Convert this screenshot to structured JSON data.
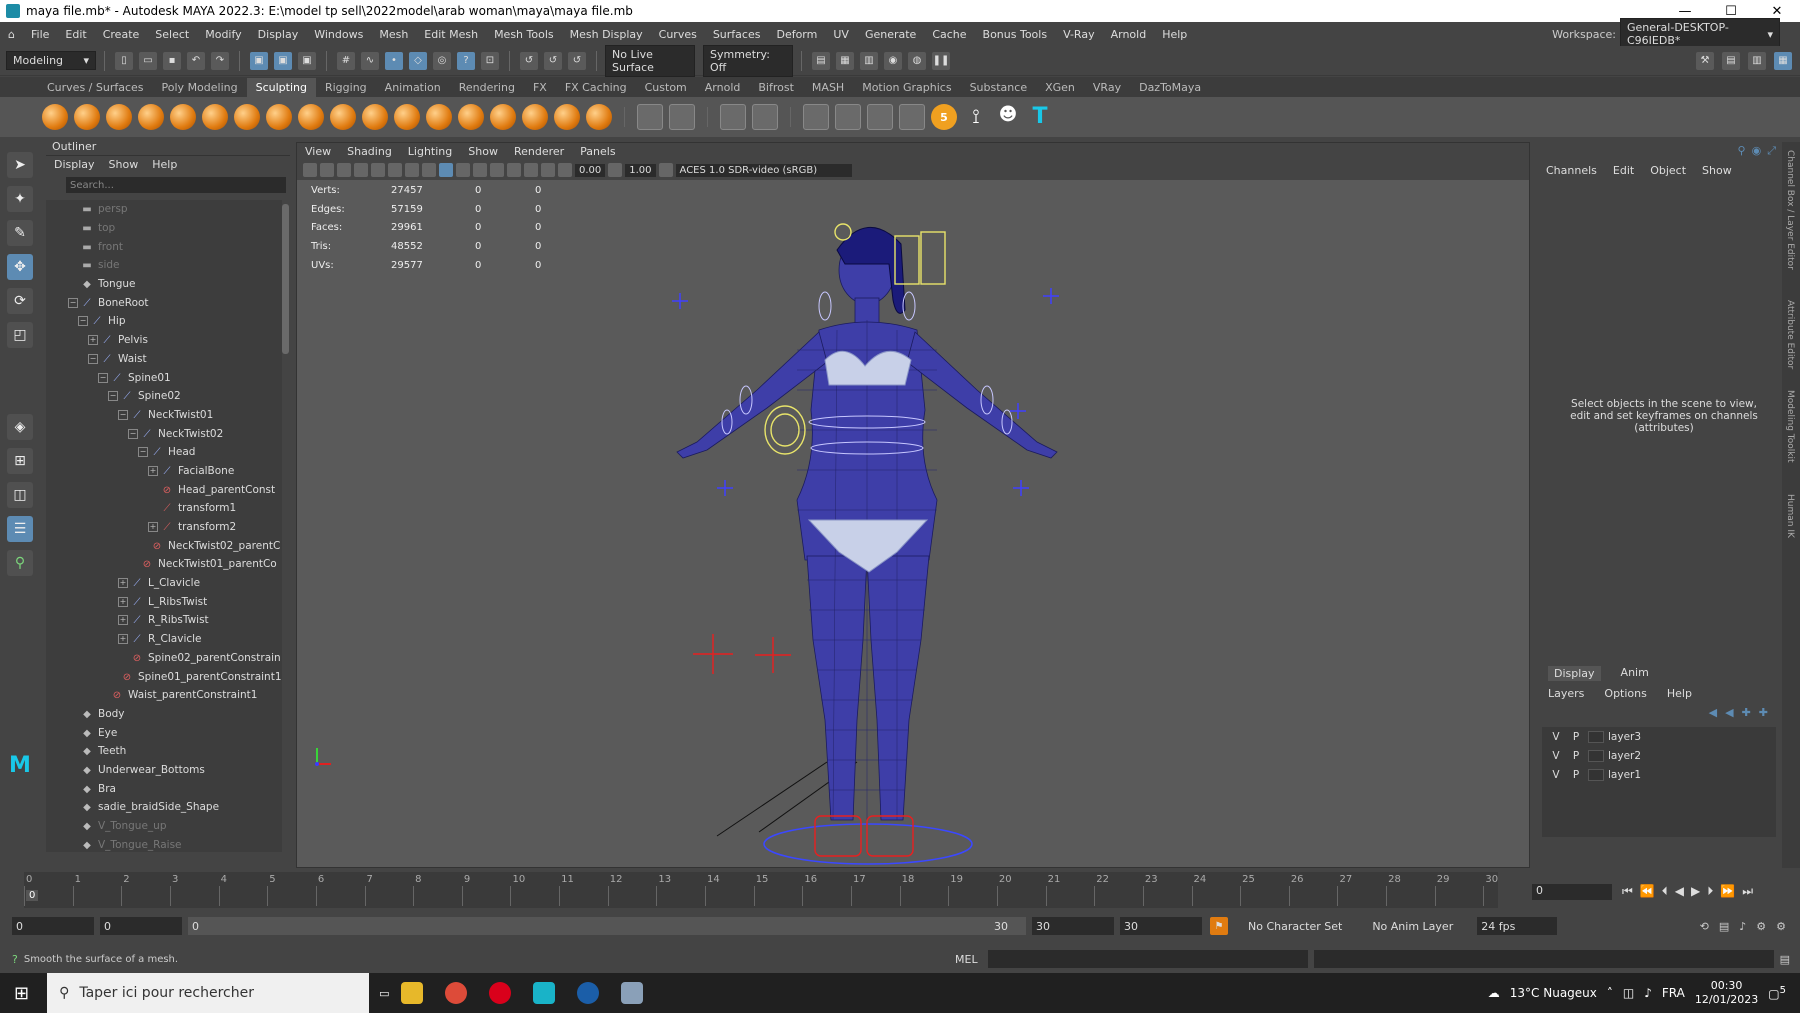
{
  "window": {
    "title": "maya file.mb* - Autodesk MAYA 2022.3: E:\\model tp sell\\2022model\\arab woman\\maya\\maya file.mb",
    "min": "—",
    "max": "☐",
    "close": "✕"
  },
  "menubar": {
    "items": [
      "File",
      "Edit",
      "Create",
      "Select",
      "Modify",
      "Display",
      "Windows",
      "Mesh",
      "Edit Mesh",
      "Mesh Tools",
      "Mesh Display",
      "Curves",
      "Surfaces",
      "Deform",
      "UV",
      "Generate",
      "Cache",
      "Bonus Tools",
      "V-Ray",
      "Arnold",
      "Help"
    ],
    "workspace_label": "Workspace:",
    "workspace_value": "General-DESKTOP-C96IEDB*"
  },
  "toolbar": {
    "mode": "Modeling",
    "live_surface": "No Live Surface",
    "symmetry": "Symmetry: Off"
  },
  "shelf": {
    "tabs": [
      "Curves / Surfaces",
      "Poly Modeling",
      "Sculpting",
      "Rigging",
      "Animation",
      "Rendering",
      "FX",
      "FX Caching",
      "Custom",
      "Arnold",
      "Bifrost",
      "MASH",
      "Motion Graphics",
      "Substance",
      "XGen",
      "VRay",
      "DazToMaya"
    ],
    "active_tab": "Sculpting"
  },
  "outliner": {
    "title": "Outliner",
    "menu": [
      "Display",
      "Show",
      "Help"
    ],
    "search_placeholder": "Search...",
    "items": [
      {
        "label": "persp",
        "depth": 0,
        "icon": "camera",
        "dim": true
      },
      {
        "label": "top",
        "depth": 0,
        "icon": "camera",
        "dim": true
      },
      {
        "label": "front",
        "depth": 0,
        "icon": "camera",
        "dim": true
      },
      {
        "label": "side",
        "depth": 0,
        "icon": "camera",
        "dim": true
      },
      {
        "label": "Tongue",
        "depth": 0,
        "icon": "mesh"
      },
      {
        "label": "BoneRoot",
        "depth": 0,
        "icon": "joint",
        "exp": "−"
      },
      {
        "label": "Hip",
        "depth": 1,
        "icon": "joint",
        "exp": "−"
      },
      {
        "label": "Pelvis",
        "depth": 2,
        "icon": "joint",
        "exp": "+"
      },
      {
        "label": "Waist",
        "depth": 2,
        "icon": "joint",
        "exp": "−"
      },
      {
        "label": "Spine01",
        "depth": 3,
        "icon": "joint",
        "exp": "−"
      },
      {
        "label": "Spine02",
        "depth": 4,
        "icon": "joint",
        "exp": "−"
      },
      {
        "label": "NeckTwist01",
        "depth": 5,
        "icon": "joint",
        "exp": "−"
      },
      {
        "label": "NeckTwist02",
        "depth": 6,
        "icon": "joint",
        "exp": "−"
      },
      {
        "label": "Head",
        "depth": 7,
        "icon": "joint",
        "exp": "−"
      },
      {
        "label": "FacialBone",
        "depth": 8,
        "icon": "joint",
        "exp": "+"
      },
      {
        "label": "Head_parentConst",
        "depth": 8,
        "icon": "constraint"
      },
      {
        "label": "transform1",
        "depth": 8,
        "icon": "transform"
      },
      {
        "label": "transform2",
        "depth": 8,
        "icon": "transform",
        "exp": "+"
      },
      {
        "label": "NeckTwist02_parentC",
        "depth": 7,
        "icon": "constraint"
      },
      {
        "label": "NeckTwist01_parentCo",
        "depth": 6,
        "icon": "constraint"
      },
      {
        "label": "L_Clavicle",
        "depth": 5,
        "icon": "joint",
        "exp": "+"
      },
      {
        "label": "L_RibsTwist",
        "depth": 5,
        "icon": "joint",
        "exp": "+"
      },
      {
        "label": "R_RibsTwist",
        "depth": 5,
        "icon": "joint",
        "exp": "+"
      },
      {
        "label": "R_Clavicle",
        "depth": 5,
        "icon": "joint",
        "exp": "+"
      },
      {
        "label": "Spine02_parentConstrain",
        "depth": 5,
        "icon": "constraint"
      },
      {
        "label": "Spine01_parentConstraint1",
        "depth": 4,
        "icon": "constraint"
      },
      {
        "label": "Waist_parentConstraint1",
        "depth": 3,
        "icon": "constraint"
      },
      {
        "label": "Body",
        "depth": 0,
        "icon": "mesh"
      },
      {
        "label": "Eye",
        "depth": 0,
        "icon": "mesh"
      },
      {
        "label": "Teeth",
        "depth": 0,
        "icon": "mesh"
      },
      {
        "label": "Underwear_Bottoms",
        "depth": 0,
        "icon": "mesh"
      },
      {
        "label": "Bra",
        "depth": 0,
        "icon": "mesh"
      },
      {
        "label": "sadie_braidSide_Shape",
        "depth": 0,
        "icon": "mesh"
      },
      {
        "label": "V_Tongue_up",
        "depth": 0,
        "icon": "mesh",
        "dim": true
      },
      {
        "label": "V_Tongue_Raise",
        "depth": 0,
        "icon": "mesh",
        "dim": true
      }
    ]
  },
  "viewport": {
    "menu": [
      "View",
      "Shading",
      "Lighting",
      "Show",
      "Renderer",
      "Panels"
    ],
    "exposure": "0.00",
    "gamma": "1.00",
    "colorspace": "ACES 1.0 SDR-video (sRGB)",
    "hud": [
      {
        "label": "Verts:",
        "v": "27457",
        "a": "0",
        "b": "0"
      },
      {
        "label": "Edges:",
        "v": "57159",
        "a": "0",
        "b": "0"
      },
      {
        "label": "Faces:",
        "v": "29961",
        "a": "0",
        "b": "0"
      },
      {
        "label": "Tris:",
        "v": "48552",
        "a": "0",
        "b": "0"
      },
      {
        "label": "UVs:",
        "v": "29577",
        "a": "0",
        "b": "0"
      }
    ]
  },
  "channelbox": {
    "menu": [
      "Channels",
      "Edit",
      "Object",
      "Show"
    ],
    "message": "Select objects in the scene to view, edit and set keyframes on channels (attributes)"
  },
  "layers": {
    "tabs": [
      "Display",
      "Anim"
    ],
    "menu": [
      "Layers",
      "Options",
      "Help"
    ],
    "rows": [
      {
        "v": "V",
        "p": "P",
        "name": "layer3"
      },
      {
        "v": "V",
        "p": "P",
        "name": "layer2"
      },
      {
        "v": "V",
        "p": "P",
        "name": "layer1"
      }
    ]
  },
  "rightstrip": [
    "Channel Box / Layer Editor",
    "Attribute Editor",
    "Modeling Toolkit",
    "Human IK"
  ],
  "timeline": {
    "ticks": [
      "0",
      "1",
      "2",
      "3",
      "4",
      "5",
      "6",
      "7",
      "8",
      "9",
      "10",
      "11",
      "12",
      "13",
      "14",
      "15",
      "16",
      "17",
      "18",
      "19",
      "20",
      "21",
      "22",
      "23",
      "24",
      "25",
      "26",
      "27",
      "28",
      "29",
      "30"
    ],
    "current_frame": "0",
    "frame_field": "0"
  },
  "range": {
    "start": "0",
    "anim_start": "0",
    "slider_start": "0",
    "slider_end": "30",
    "anim_end": "30",
    "end": "30",
    "character_set": "No Character Set",
    "anim_layer": "No Anim Layer",
    "fps": "24 fps"
  },
  "status": {
    "help": "Smooth the surface of a mesh.",
    "lang": "MEL"
  },
  "taskbar": {
    "search": "Taper ici pour rechercher",
    "weather": "13°C  Nuageux",
    "lang": "FRA",
    "time": "00:30",
    "date": "12/01/2023",
    "notif": "5"
  }
}
